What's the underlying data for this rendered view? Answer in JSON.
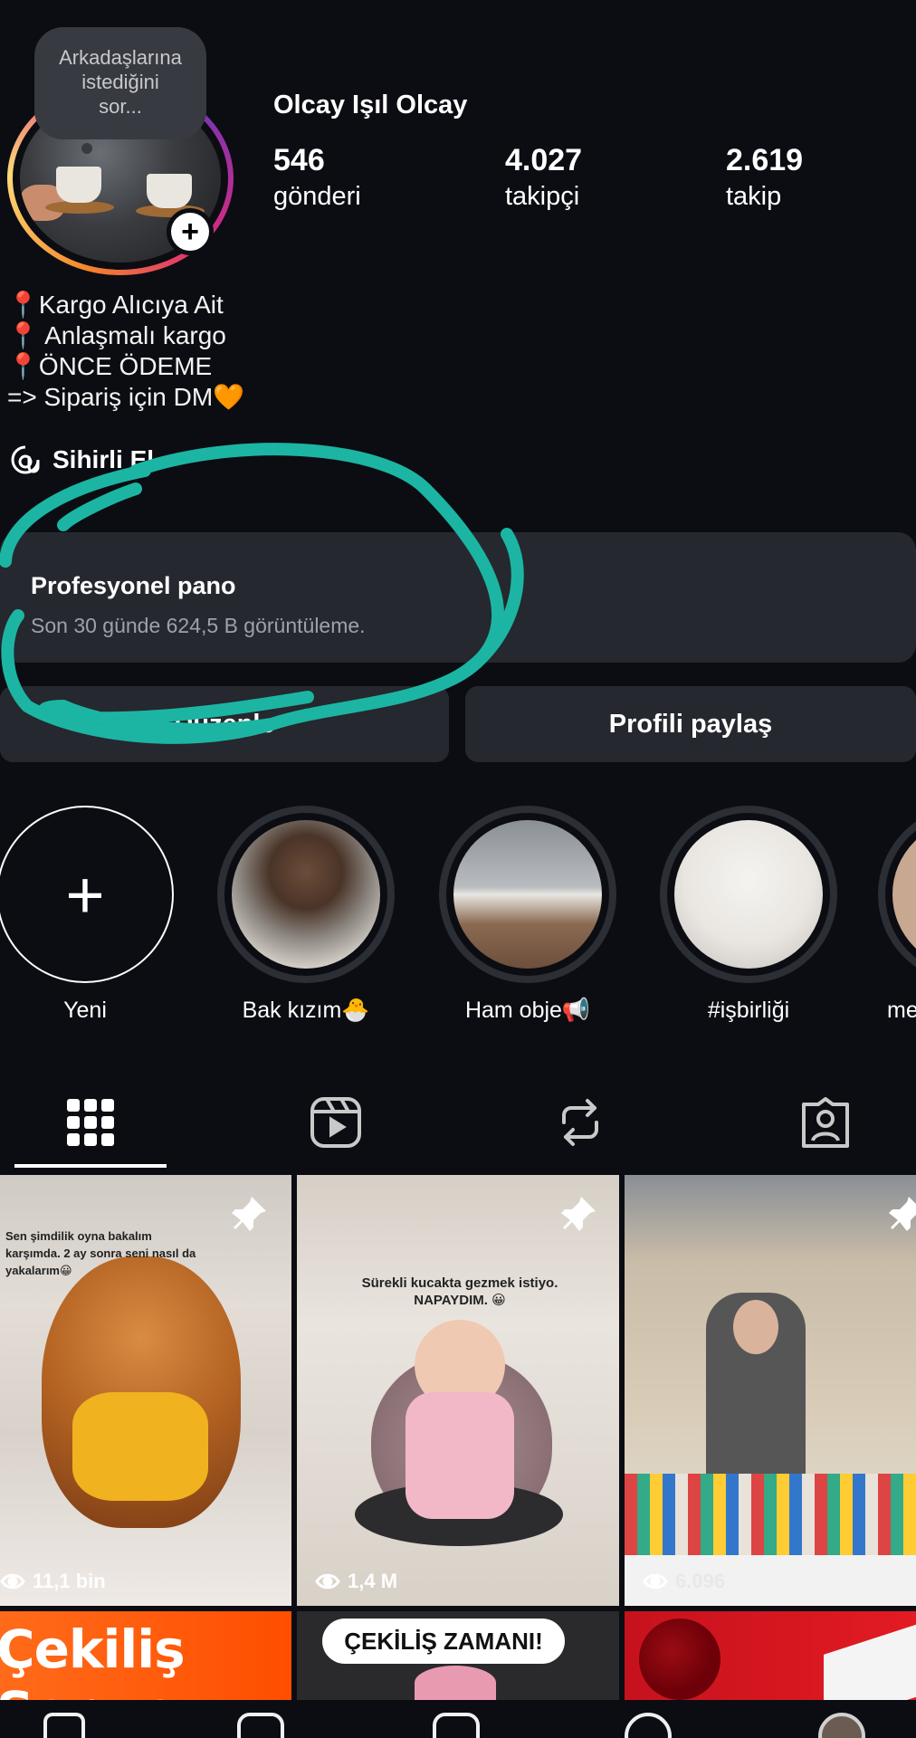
{
  "profile": {
    "note": [
      "Arkadaşlarına",
      "istediğini",
      "sor..."
    ],
    "name": "Olcay Işıl Olcay",
    "stats": [
      {
        "num": "546",
        "label": "gönderi"
      },
      {
        "num": "4.027",
        "label": "takipçi"
      },
      {
        "num": "2.619",
        "label": "takip"
      }
    ],
    "bio": {
      "line1": "Kargo Alıcıya Ait",
      "line2": " Anlaşmalı kargo",
      "line3": "ÖNCE ÖDEME",
      "line4": "=> Sipariş için DM",
      "pin_emoji": "📍",
      "heart_emoji": "🧡"
    },
    "threads_label": "Sihirli El"
  },
  "dashboard": {
    "title": "Profesyonel pano",
    "subtitle": "Son 30 günde 624,5 B görüntüleme."
  },
  "buttons": {
    "edit": "Düzenle",
    "share": "Profili paylaş"
  },
  "highlights": [
    {
      "label": "Yeni"
    },
    {
      "label": "Bak kızım🐣"
    },
    {
      "label": "Ham obje📢"
    },
    {
      "label": "#işbirliği"
    },
    {
      "label": "me"
    }
  ],
  "tabs": [
    "grid-icon",
    "reels-icon",
    "reposts-icon",
    "tagged-icon"
  ],
  "grid": {
    "post1": {
      "caption": "Sen şimdilik oyna bakalım karşımda. 2 ay sonra seni nasıl da yakalarım😀",
      "views": "11,1 bin"
    },
    "post2": {
      "caption": "Sürekli kucakta gezmek istiyo. NAPAYDIM. 😀",
      "views": "1,4 M"
    },
    "post3": {
      "views": "6.096"
    },
    "post4": {
      "banner": "Çekiliş Sonucu :"
    },
    "post5": {
      "banner": "ÇEKİLİŞ ZAMANI!"
    }
  },
  "colors": {
    "background": "#0b0d12",
    "card": "#25282e",
    "annotation": "#1cb5a3"
  }
}
